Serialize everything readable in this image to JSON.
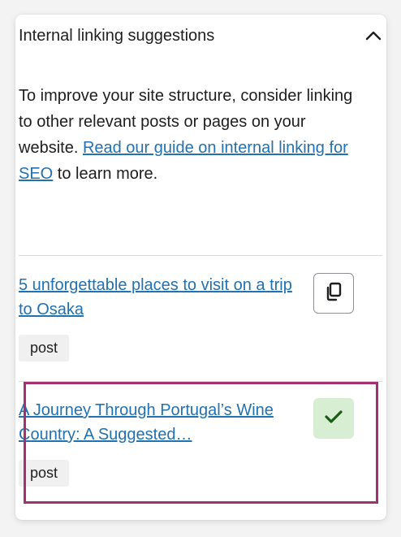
{
  "panel": {
    "title": "Internal linking suggestions",
    "intro_text_before": "To improve your site structure, consider linking to other relevant posts or pages on your website. ",
    "intro_link": "Read our guide on internal linking for SEO",
    "intro_text_after": " to learn more."
  },
  "suggestions": [
    {
      "title": "5 unforgettable places to visit on a trip to Osaka",
      "type": "post",
      "action": "copy-link-icon"
    },
    {
      "title": "A Journey Through Portugal’s Wine Country: A Suggested…",
      "type": "post",
      "action": "check-icon",
      "selected": true
    }
  ],
  "colors": {
    "link": "#2271b1",
    "highlight": "#a4316f",
    "check_bg": "#d8eed3",
    "check": "#1a5c14"
  }
}
